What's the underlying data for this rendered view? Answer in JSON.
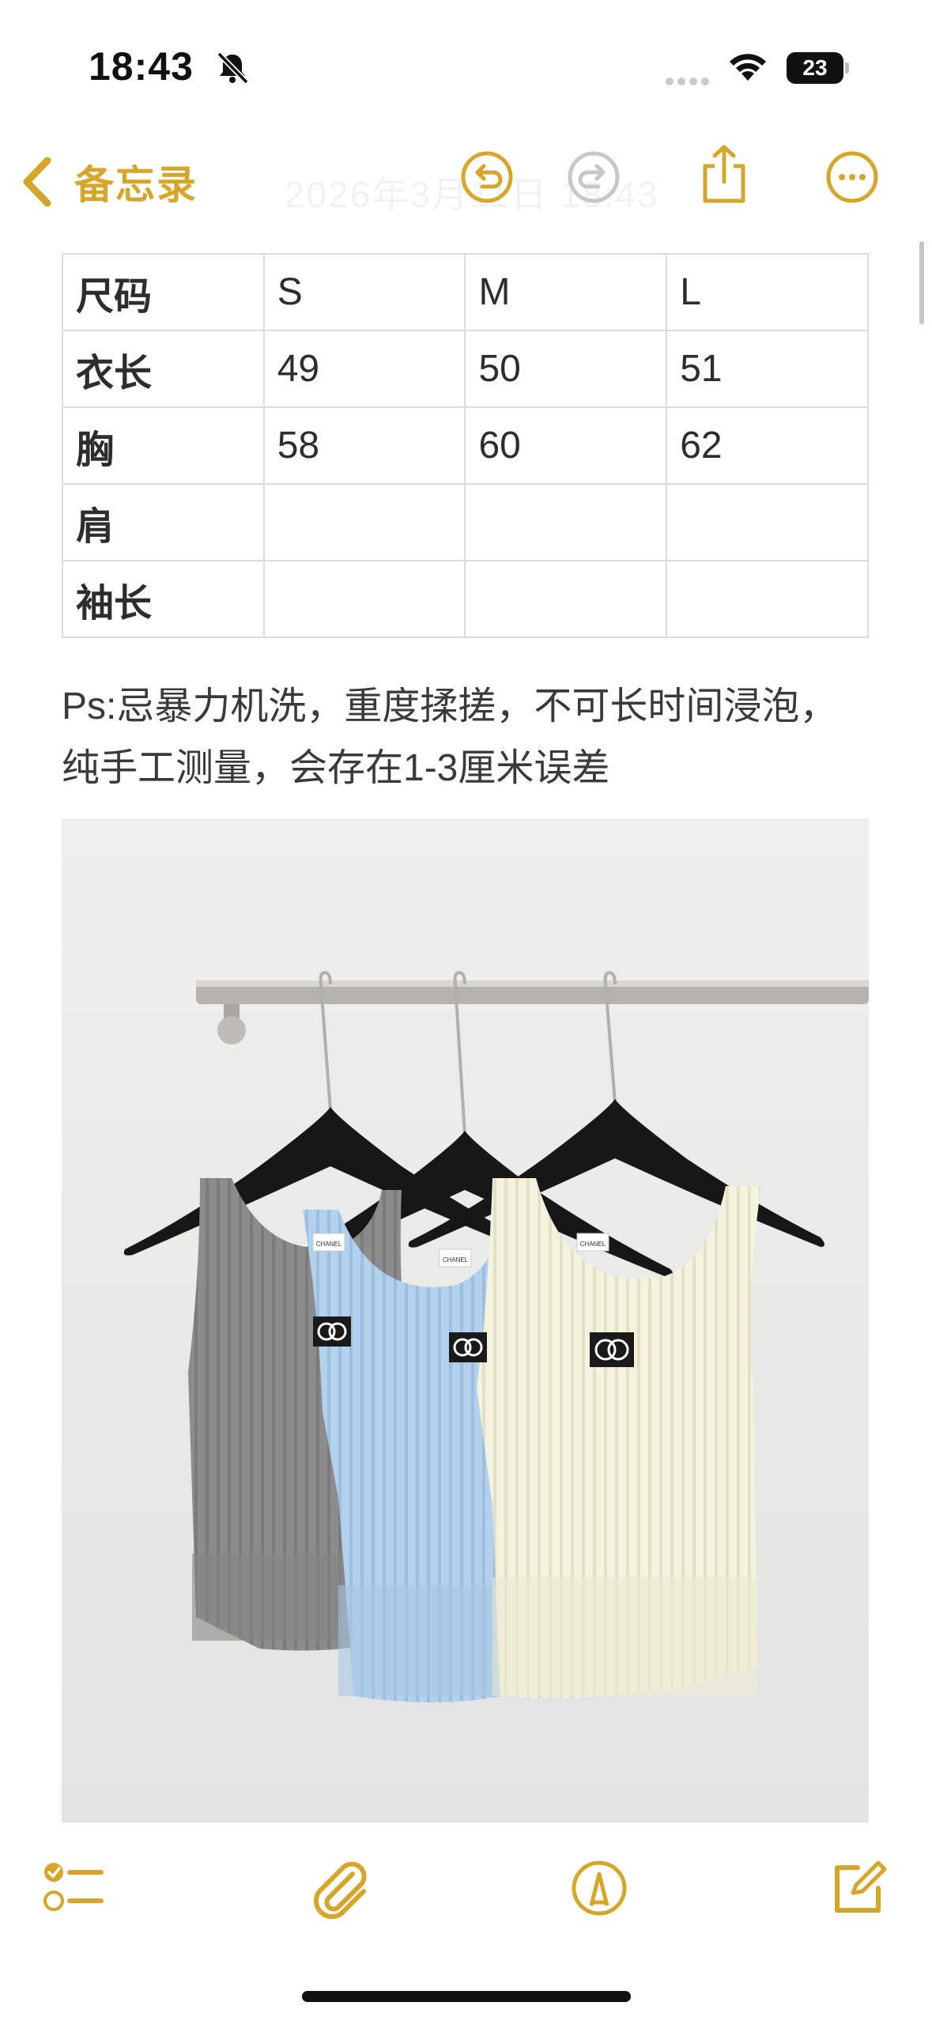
{
  "status_bar": {
    "time": "18:43",
    "battery_level": "23",
    "silent_icon": "bell-slash-icon"
  },
  "nav": {
    "back_label": "备忘录",
    "title": "2026年3月11日 18:43"
  },
  "table": {
    "rows": [
      [
        "尺码",
        "S",
        "M",
        "L"
      ],
      [
        "衣长",
        "49",
        "50",
        "51"
      ],
      [
        "胸",
        "58",
        "60",
        "62"
      ],
      [
        "肩",
        "",
        "",
        ""
      ],
      [
        "袖长",
        "",
        "",
        ""
      ]
    ]
  },
  "note_lines": [
    "Ps:忌暴力机洗，重度揉搓，不可长时间浸泡，",
    "纯手工测量，会存在1-3厘米误差"
  ],
  "photo": {
    "tag_text": "CHANEL",
    "colors": {
      "grey_top": "#8c8c8c",
      "blue_top": "#b3d1ec",
      "cream_top": "#f5f3de",
      "wall": "#ebebea"
    }
  },
  "accent_color": "#d6a62a"
}
